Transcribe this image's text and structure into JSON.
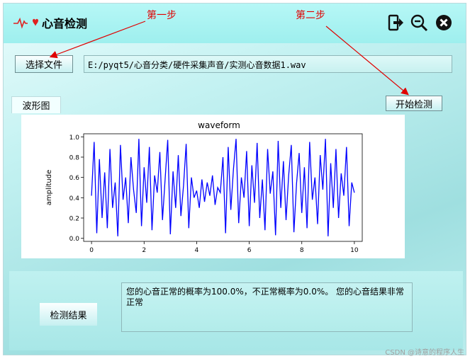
{
  "app": {
    "title": "心音检测",
    "logo_icon": "heartbeat-icon"
  },
  "titlebar_buttons": [
    {
      "name": "exit-button",
      "icon": "exit-icon"
    },
    {
      "name": "minimize-button",
      "icon": "zoom-out-icon"
    },
    {
      "name": "close-button",
      "icon": "close-icon"
    }
  ],
  "controls": {
    "select_file_label": "选择文件",
    "file_path": "E:/pyqt5/心音分类/硬件采集声音/实测心音数据1.wav",
    "start_label": "开始检测"
  },
  "tabs": {
    "waveform_tab": "波形图"
  },
  "annotations": {
    "step1": "第一步",
    "step2": "第二步"
  },
  "result": {
    "label": "检测结果",
    "text": "您的心音正常的概率为100.0%，不正常概率为0.0%。 您的心音结果非常正常"
  },
  "watermark": "CSDN @诗意的程序人生",
  "colors": {
    "accent": "#0000ff",
    "annotation": "#e00000",
    "panel": "#a8e7e7"
  },
  "chart_data": {
    "type": "line",
    "title": "waveform",
    "xlabel": "",
    "ylabel": "amplitude",
    "xlim": [
      -0.3,
      10.3
    ],
    "ylim": [
      -0.03,
      1.03
    ],
    "xticks": [
      "0",
      "2",
      "4",
      "6",
      "8",
      "10"
    ],
    "yticks": [
      "0.0",
      "0.2",
      "0.4",
      "0.6",
      "0.8",
      "1.0"
    ],
    "series": [
      {
        "color": "#0000ff",
        "x": [
          0,
          0.1,
          0.2,
          0.3,
          0.4,
          0.5,
          0.6,
          0.7,
          0.8,
          0.9,
          1.0,
          1.1,
          1.2,
          1.3,
          1.4,
          1.5,
          1.6,
          1.7,
          1.8,
          1.9,
          2.0,
          2.1,
          2.2,
          2.3,
          2.4,
          2.5,
          2.6,
          2.7,
          2.8,
          2.9,
          3.0,
          3.1,
          3.2,
          3.3,
          3.4,
          3.5,
          3.6,
          3.7,
          3.8,
          3.9,
          4.0,
          4.1,
          4.2,
          4.3,
          4.4,
          4.5,
          4.6,
          4.7,
          4.8,
          4.9,
          5.0,
          5.1,
          5.2,
          5.3,
          5.4,
          5.5,
          5.6,
          5.7,
          5.8,
          5.9,
          6.0,
          6.1,
          6.2,
          6.3,
          6.4,
          6.5,
          6.6,
          6.7,
          6.8,
          6.9,
          7.0,
          7.1,
          7.2,
          7.3,
          7.4,
          7.5,
          7.6,
          7.7,
          7.8,
          7.9,
          8.0,
          8.1,
          8.2,
          8.3,
          8.4,
          8.5,
          8.6,
          8.7,
          8.8,
          8.9,
          9.0,
          9.1,
          9.2,
          9.3,
          9.4,
          9.5,
          9.6,
          9.7,
          9.8,
          9.9,
          10.0
        ],
        "y": [
          0.42,
          0.95,
          0.05,
          0.78,
          0.2,
          0.65,
          0.1,
          0.88,
          0.3,
          0.55,
          0.02,
          0.92,
          0.38,
          0.6,
          0.15,
          0.8,
          0.48,
          0.25,
          0.98,
          0.12,
          0.7,
          0.35,
          0.9,
          0.08,
          0.62,
          0.45,
          0.85,
          0.18,
          0.58,
          0.97,
          0.04,
          0.66,
          0.3,
          0.82,
          0.22,
          0.52,
          0.93,
          0.1,
          0.6,
          0.4,
          0.47,
          0.3,
          0.58,
          0.36,
          0.55,
          0.42,
          0.62,
          0.33,
          0.5,
          0.45,
          0.8,
          0.05,
          0.9,
          0.28,
          0.68,
          0.98,
          0.15,
          0.6,
          0.4,
          0.86,
          0.12,
          0.72,
          0.35,
          0.94,
          0.2,
          0.58,
          0.08,
          0.88,
          0.44,
          0.66,
          0.03,
          0.96,
          0.3,
          0.76,
          0.18,
          0.62,
          0.92,
          0.06,
          0.54,
          0.84,
          0.25,
          0.7,
          0.1,
          0.95,
          0.38,
          0.6,
          0.14,
          0.82,
          0.48,
          0.98,
          0.02,
          0.74,
          0.3,
          0.88,
          0.2,
          0.64,
          0.42,
          0.9,
          0.12,
          0.55,
          0.45
        ]
      }
    ]
  }
}
